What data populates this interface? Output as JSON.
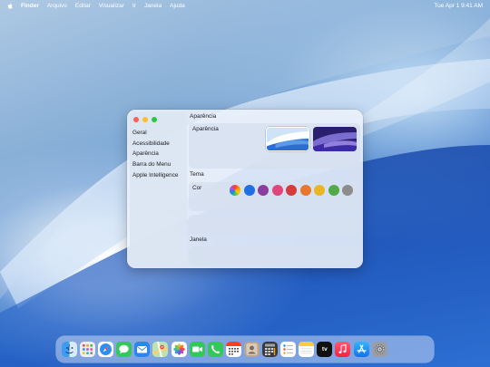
{
  "menubar": {
    "app_name": "Finder",
    "items": [
      "Arquivo",
      "Editar",
      "Visualizar",
      "Ir",
      "Janela",
      "Ajuda"
    ],
    "clock": "Tue Apr 1  9:41 AM"
  },
  "window": {
    "title": "Aparência",
    "sidebar": {
      "items": [
        "Geral",
        "Acessibilidade",
        "Aparência",
        "Barra do Menu",
        "Apple Intelligence"
      ]
    },
    "appearance_panel": {
      "label": "Aparência"
    },
    "tema_section": {
      "heading": "Tema",
      "cor_label": "Cor"
    },
    "color_swatches": [
      {
        "name": "multicolor",
        "color": "multicolor"
      },
      {
        "name": "blue",
        "color": "#1f6fe5"
      },
      {
        "name": "purple",
        "color": "#8a3d9e"
      },
      {
        "name": "pink",
        "color": "#e0457b"
      },
      {
        "name": "red",
        "color": "#d63b3b"
      },
      {
        "name": "orange",
        "color": "#e8772d"
      },
      {
        "name": "yellow",
        "color": "#e9b623"
      },
      {
        "name": "green",
        "color": "#52a948"
      },
      {
        "name": "graphite",
        "color": "#8c8c8c"
      }
    ],
    "janela_section": {
      "heading": "Janela"
    }
  },
  "dock": {
    "apps": [
      {
        "name": "Finder",
        "icon": "finder-icon"
      },
      {
        "name": "Launchpad",
        "icon": "launchpad-icon"
      },
      {
        "name": "Safari",
        "icon": "safari-icon"
      },
      {
        "name": "Messages",
        "icon": "messages-icon"
      },
      {
        "name": "Mail",
        "icon": "mail-icon"
      },
      {
        "name": "Maps",
        "icon": "maps-icon"
      },
      {
        "name": "Photos",
        "icon": "photos-icon"
      },
      {
        "name": "FaceTime",
        "icon": "facetime-icon"
      },
      {
        "name": "Phone",
        "icon": "phone-icon"
      },
      {
        "name": "Calendar",
        "icon": "calendar-icon"
      },
      {
        "name": "Contacts",
        "icon": "contacts-icon"
      },
      {
        "name": "Calculator",
        "icon": "calculator-icon"
      },
      {
        "name": "Reminders",
        "icon": "reminders-icon"
      },
      {
        "name": "Notes",
        "icon": "notes-icon"
      },
      {
        "name": "TV",
        "icon": "tv-icon",
        "label": "tv"
      },
      {
        "name": "Music",
        "icon": "music-icon"
      },
      {
        "name": "App Store",
        "icon": "app-store-icon"
      },
      {
        "name": "System Settings",
        "icon": "settings-icon"
      }
    ]
  }
}
